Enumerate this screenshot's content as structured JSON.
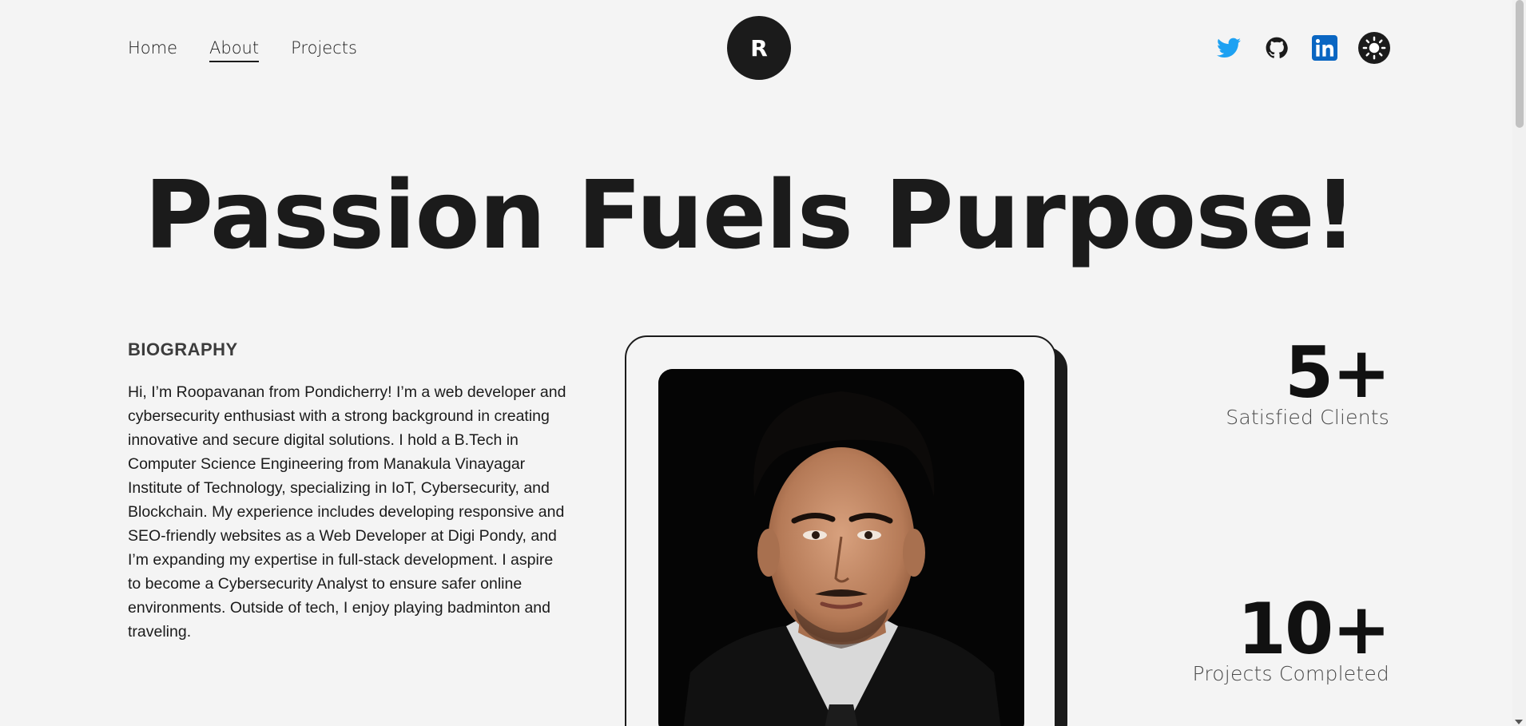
{
  "nav": {
    "items": [
      {
        "label": "Home",
        "active": false
      },
      {
        "label": "About",
        "active": true
      },
      {
        "label": "Projects",
        "active": false
      }
    ]
  },
  "logo": {
    "letter": "R"
  },
  "socials": [
    {
      "icon": "twitter-icon",
      "color": "#1da1f2"
    },
    {
      "icon": "github-icon",
      "color": "#1b1b1b"
    },
    {
      "icon": "linkedin-icon",
      "color": "#0a66c2"
    }
  ],
  "theme_toggle": {
    "icon": "sun-icon"
  },
  "hero": {
    "title": "Passion Fuels Purpose!"
  },
  "biography": {
    "heading": "BIOGRAPHY",
    "text": "Hi, I’m Roopavanan from Pondicherry! I’m a web developer and cybersecurity enthusiast with a strong background in creating innovative and secure digital solutions. I hold a B.Tech in Computer Science Engineering from Manakula Vinayagar Institute of Technology, specializing in IoT, Cybersecurity, and Blockchain. My experience includes developing responsive and SEO-friendly websites as a Web Developer at Digi Pondy, and I’m expanding my expertise in full-stack development. I aspire to become a Cybersecurity Analyst to ensure safer online environments. Outside of tech, I enjoy playing badminton and traveling."
  },
  "stats": [
    {
      "value": "5+",
      "label": "Satisfied Clients"
    },
    {
      "value": "10+",
      "label": "Projects Completed"
    }
  ],
  "colors": {
    "background": "#f4f4f4",
    "text": "#1b1b1b"
  }
}
